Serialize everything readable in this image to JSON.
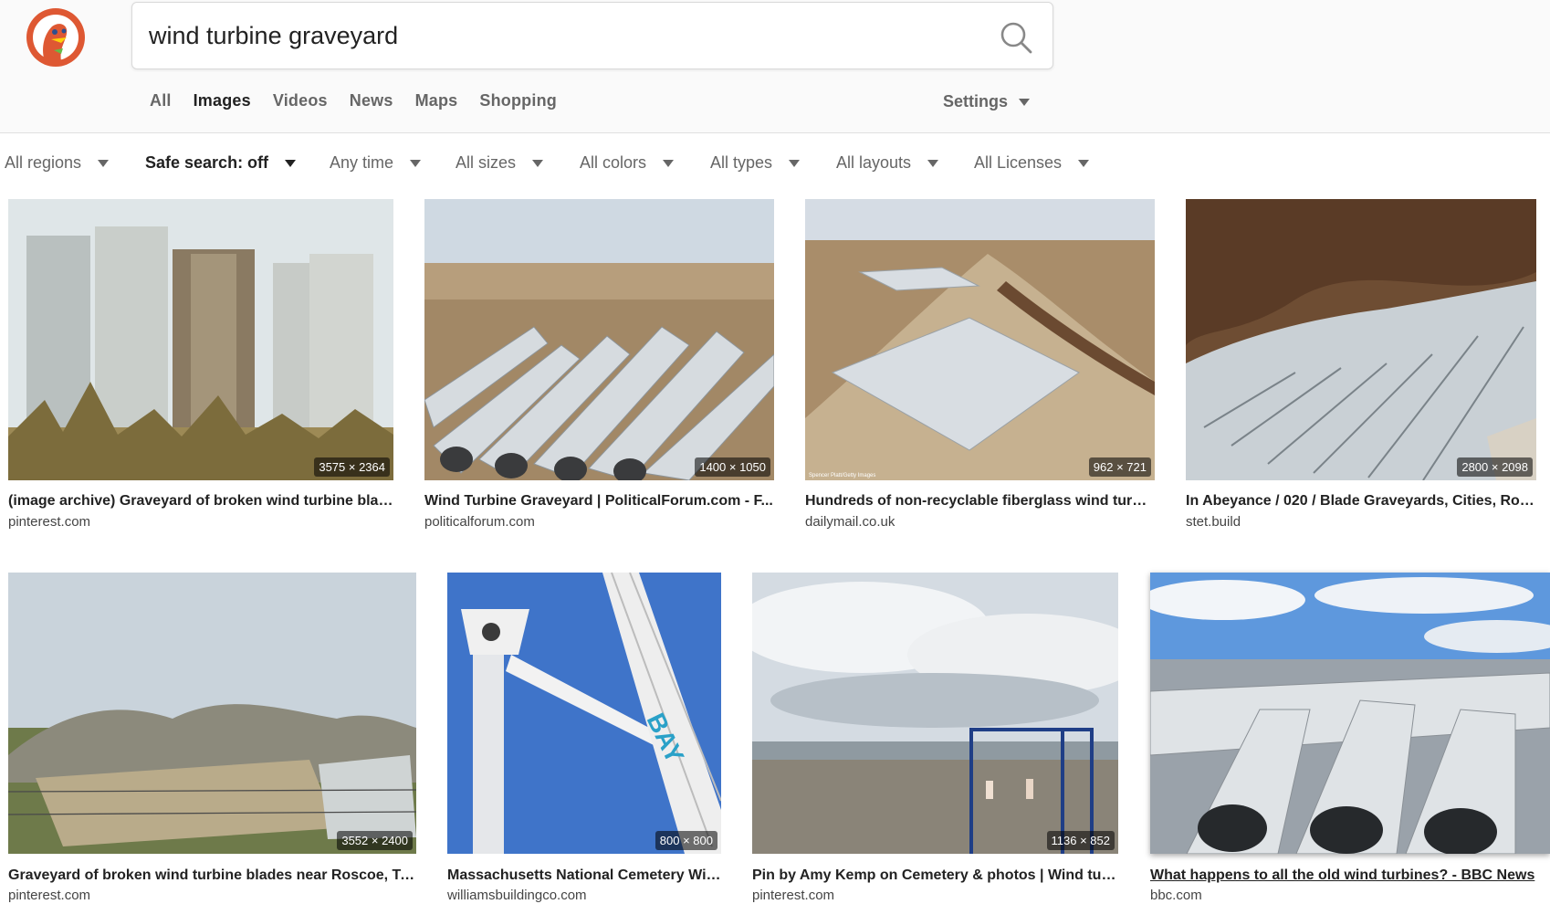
{
  "search": {
    "query": "wind turbine graveyard"
  },
  "tabs": [
    "All",
    "Images",
    "Videos",
    "News",
    "Maps",
    "Shopping"
  ],
  "active_tab": "Images",
  "settings_label": "Settings",
  "filters": [
    "All regions",
    "Safe search: off",
    "Any time",
    "All sizes",
    "All colors",
    "All types",
    "All layouts",
    "All Licenses"
  ],
  "results": [
    {
      "dims": "3575 × 2364",
      "title": "(image archive) Graveyard of broken wind turbine blad...",
      "source": "pinterest.com"
    },
    {
      "dims": "1400 × 1050",
      "title": "Wind Turbine Graveyard | PoliticalForum.com - F...",
      "source": "politicalforum.com"
    },
    {
      "dims": "962 × 721",
      "title": "Hundreds of non-recyclable fiberglass wind turbi...",
      "source": "dailymail.co.uk",
      "watermark": "Spencer Platt/Getty Images"
    },
    {
      "dims": "2800 × 2098",
      "title": "In Abeyance / 020 / Blade Graveyards, Cities, Roa...",
      "source": "stet.build"
    },
    {
      "dims": "3552 × 2400",
      "title": "Graveyard of broken wind turbine blades near Roscoe, Te...",
      "source": "pinterest.com"
    },
    {
      "dims": "800 × 800",
      "title": "Massachusetts National Cemetery Win...",
      "source": "williamsbuildingco.com",
      "crane_text": "BAY"
    },
    {
      "dims": "1136 × 852",
      "title": "Pin by Amy Kemp on Cemetery & photos | Wind tur...",
      "source": "pinterest.com"
    },
    {
      "dims": "",
      "title": "What happens to all the old wind turbines? - BBC News",
      "source": "bbc.com"
    }
  ],
  "colors": {
    "brand": "#de5833",
    "text": "#222222",
    "muted": "#666666"
  },
  "icons": {
    "logo": "duck-logo-icon",
    "search": "magnifier-icon",
    "dropdown": "caret-down-icon"
  }
}
